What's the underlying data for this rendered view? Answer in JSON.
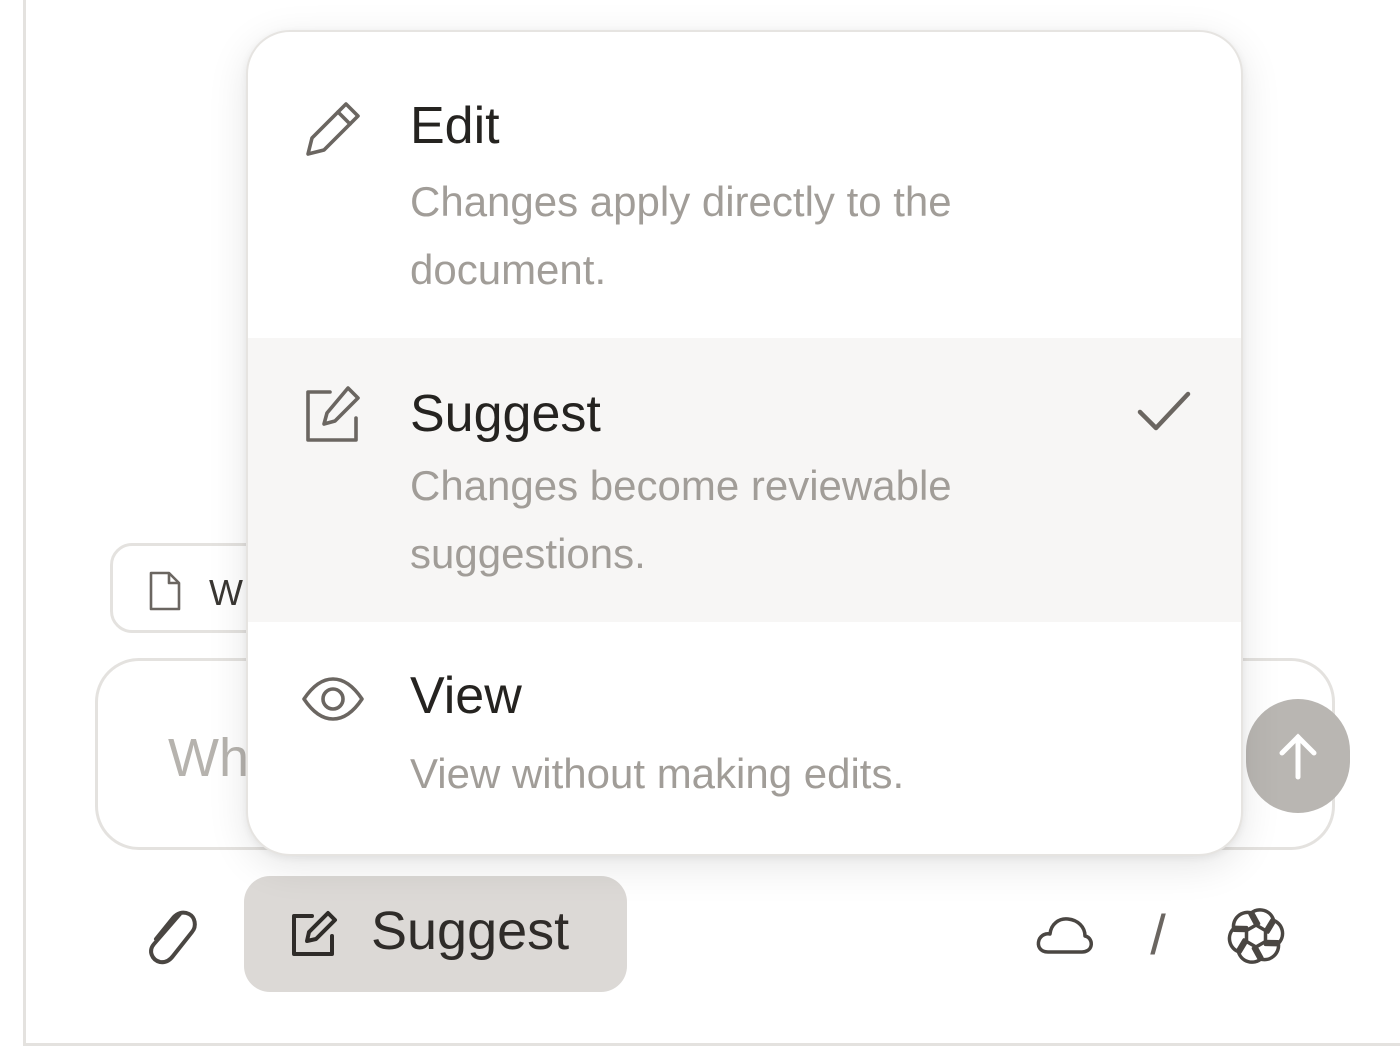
{
  "composer": {
    "attachment_label": "W",
    "placeholder": "Wh",
    "mode_button_label": "Suggest"
  },
  "mode_menu": {
    "selected": "Suggest",
    "items": [
      {
        "title": "Edit",
        "description": "Changes apply directly to the document.",
        "icon": "pencil-icon"
      },
      {
        "title": "Suggest",
        "description": "Changes become reviewable suggestions.",
        "icon": "edit-square-icon"
      },
      {
        "title": "View",
        "description": "View without making edits.",
        "icon": "eye-icon"
      }
    ]
  },
  "toolbar": {
    "divider_text": "/",
    "icons": [
      "paperclip-icon",
      "cloud-icon",
      "openai-model-icon"
    ]
  },
  "colors": {
    "menu_selected_bg": "#f7f6f5",
    "mode_button_bg": "#dcd9d6",
    "send_button_bg": "#b9b6b2",
    "title_text": "#252320",
    "description_text": "#a19d98"
  }
}
